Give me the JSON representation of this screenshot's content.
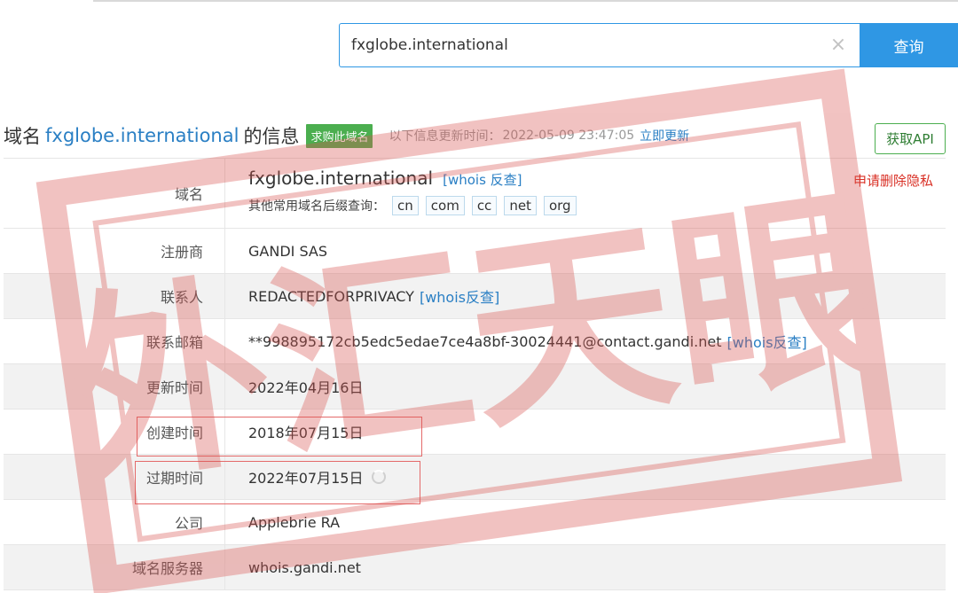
{
  "search": {
    "value": "fxglobe.international",
    "button_label": "查询"
  },
  "heading": {
    "prefix": "域名",
    "domain": "fxglobe.international",
    "suffix": "的信息",
    "buy_badge": "求购此域名",
    "update_label": "以下信息更新时间：",
    "update_time": "2022-05-09 23:47:05",
    "update_link": "立即更新",
    "api_button": "获取API"
  },
  "domain_row": {
    "label": "域名",
    "value": "fxglobe.international",
    "whois_link": "[whois 反查]",
    "privacy_link": "申请删除隐私",
    "suffix_label": "其他常用域名后缀查询：",
    "suffixes": [
      "cn",
      "com",
      "cc",
      "net",
      "org"
    ]
  },
  "rows": [
    {
      "label": "注册商",
      "value": "GANDI SAS",
      "link": ""
    },
    {
      "label": "联系人",
      "value": "REDACTEDFORPRIVACY",
      "link": "[whois反查]"
    },
    {
      "label": "联系邮箱",
      "value": "**998895172cb5edc5edae7ce4a8bf-30024441@contact.gandi.net",
      "link": "[whois反查]"
    },
    {
      "label": "更新时间",
      "value": "2022年04月16日",
      "link": ""
    },
    {
      "label": "创建时间",
      "value": "2018年07月15日",
      "link": ""
    },
    {
      "label": "过期时间",
      "value": "2022年07月15日",
      "link": ""
    },
    {
      "label": "公司",
      "value": "Applebrie RA",
      "link": ""
    },
    {
      "label": "域名服务器",
      "value": "whois.gandi.net",
      "link": ""
    }
  ],
  "watermark": {
    "text": "外汇天眼",
    "color": "#d9534f"
  },
  "colors": {
    "accent": "#2f97e4",
    "link": "#2a7fc4",
    "badge": "#4bae4f",
    "alert": "#d93025"
  }
}
